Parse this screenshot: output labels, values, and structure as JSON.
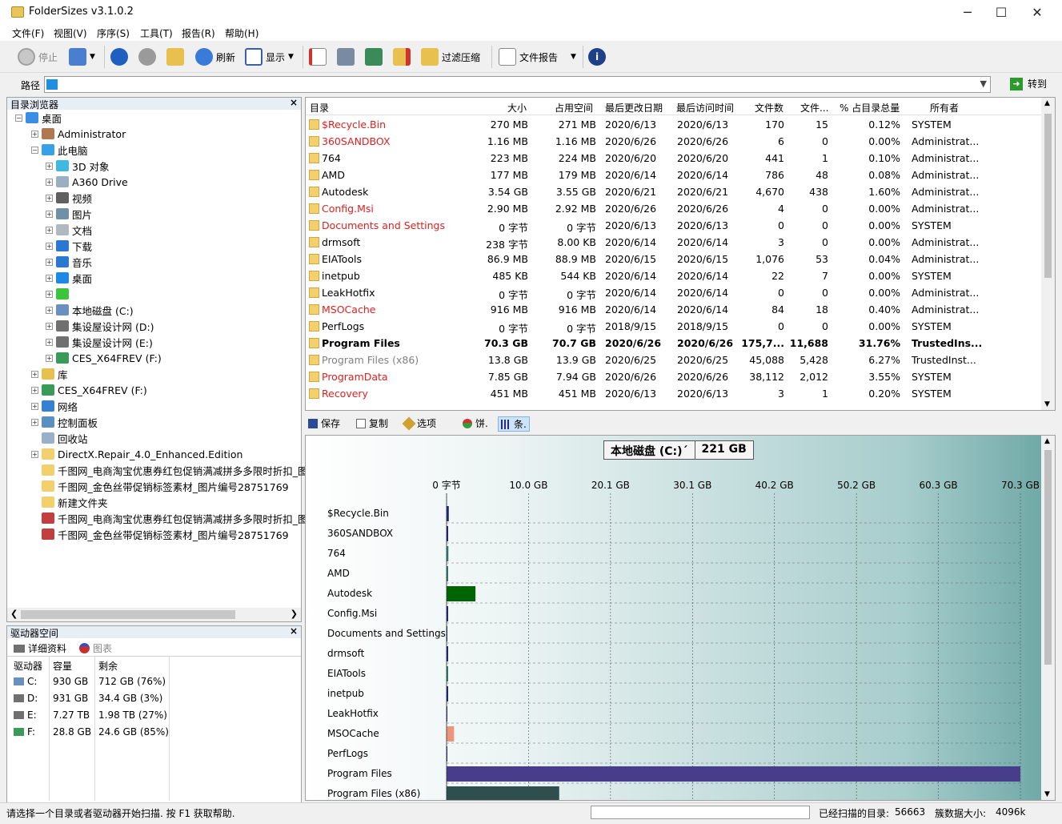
{
  "window": {
    "title": "FolderSizes v3.1.0.2",
    "minimize": "─",
    "maximize": "☐",
    "close": "✕"
  },
  "menu": [
    "文件(F)",
    "视图(V)",
    "序序(S)",
    "工具(T)",
    "报告(R)",
    "帮助(H)"
  ],
  "toolbar": {
    "stop": "停止",
    "refresh": "刷新",
    "display": "显示",
    "filter": "过滤压缩",
    "file_report": "文件报告"
  },
  "pathbar": {
    "label": "路径",
    "value": "",
    "goto": "转到"
  },
  "tree": {
    "header": "目录浏览器",
    "close": "×",
    "items": [
      {
        "label": "桌面",
        "indent": 0,
        "icon": "desktop-icon",
        "color": "#3a8ee6",
        "exp": "−"
      },
      {
        "label": "Administrator",
        "indent": 1,
        "icon": "user-icon",
        "color": "#b07850",
        "exp": "+"
      },
      {
        "label": "此电脑",
        "indent": 1,
        "icon": "computer-icon",
        "color": "#3aa0e6",
        "exp": "−"
      },
      {
        "label": "3D 对象",
        "indent": 2,
        "icon": "cube-icon",
        "color": "#40b8e0",
        "exp": "+"
      },
      {
        "label": "A360 Drive",
        "indent": 2,
        "icon": "cloud-icon",
        "color": "#9ab0c0",
        "exp": "+"
      },
      {
        "label": "视频",
        "indent": 2,
        "icon": "video-icon",
        "color": "#606060",
        "exp": "+"
      },
      {
        "label": "图片",
        "indent": 2,
        "icon": "picture-icon",
        "color": "#7090a8",
        "exp": "+"
      },
      {
        "label": "文档",
        "indent": 2,
        "icon": "document-icon",
        "color": "#b0b8c0",
        "exp": "+"
      },
      {
        "label": "下载",
        "indent": 2,
        "icon": "download-icon",
        "color": "#2a78d0",
        "exp": "+"
      },
      {
        "label": "音乐",
        "indent": 2,
        "icon": "music-icon",
        "color": "#2a78d0",
        "exp": "+"
      },
      {
        "label": "桌面",
        "indent": 2,
        "icon": "desktop-icon",
        "color": "#1e88e5",
        "exp": "+"
      },
      {
        "label": "",
        "indent": 2,
        "icon": "app-icon",
        "color": "#3cc43c",
        "exp": "+"
      },
      {
        "label": "本地磁盘 (C:)",
        "indent": 2,
        "icon": "drive-icon",
        "color": "#6a90c0",
        "exp": "+"
      },
      {
        "label": "集设屋设计网 (D:)",
        "indent": 2,
        "icon": "drive-icon",
        "color": "#707070",
        "exp": "+"
      },
      {
        "label": "集设屋设计网 (E:)",
        "indent": 2,
        "icon": "drive-icon",
        "color": "#707070",
        "exp": "+"
      },
      {
        "label": "CES_X64FREV (F:)",
        "indent": 2,
        "icon": "dvd-drive-icon",
        "color": "#3a9a5a",
        "exp": "+"
      },
      {
        "label": "库",
        "indent": 1,
        "icon": "library-icon",
        "color": "#e8c050",
        "exp": "+"
      },
      {
        "label": "CES_X64FREV (F:)",
        "indent": 1,
        "icon": "dvd-drive-icon",
        "color": "#3a9a5a",
        "exp": "+"
      },
      {
        "label": "网络",
        "indent": 1,
        "icon": "network-icon",
        "color": "#3a80d0",
        "exp": "+"
      },
      {
        "label": "控制面板",
        "indent": 1,
        "icon": "control-panel-icon",
        "color": "#5a90c0",
        "exp": "+"
      },
      {
        "label": "回收站",
        "indent": 1,
        "icon": "recycle-bin-icon",
        "color": "#9ab0c8",
        "exp": ""
      },
      {
        "label": "DirectX.Repair_4.0_Enhanced.Edition",
        "indent": 1,
        "icon": "folder-icon",
        "color": "#f2d06e",
        "exp": "+"
      },
      {
        "label": "千图网_电商淘宝优惠券红包促销满减拼多多限时折扣_图片",
        "indent": 1,
        "icon": "folder-icon",
        "color": "#f2d06e",
        "exp": ""
      },
      {
        "label": "千图网_金色丝带促销标签素材_图片编号28751769",
        "indent": 1,
        "icon": "folder-icon",
        "color": "#f2d06e",
        "exp": ""
      },
      {
        "label": "新建文件夹",
        "indent": 1,
        "icon": "folder-icon",
        "color": "#f2d06e",
        "exp": ""
      },
      {
        "label": "千图网_电商淘宝优惠券红包促销满减拼多多限时折扣_图片",
        "indent": 1,
        "icon": "archive-icon",
        "color": "#c04040",
        "exp": ""
      },
      {
        "label": "千图网_金色丝带促销标签素材_图片编号28751769",
        "indent": 1,
        "icon": "archive-icon",
        "color": "#c04040",
        "exp": ""
      }
    ]
  },
  "drives": {
    "header": "驱动器空间",
    "close": "×",
    "tab_details": "详细资料",
    "tab_chart": "图表",
    "columns": [
      "驱动器",
      "容量",
      "剩余"
    ],
    "rows": [
      {
        "drive": "C:",
        "capacity": "930 GB",
        "free": "712 GB (76%)",
        "color": "#6a90c0"
      },
      {
        "drive": "D:",
        "capacity": "931 GB",
        "free": "34.4 GB (3%)",
        "color": "#707070"
      },
      {
        "drive": "E:",
        "capacity": "7.27 TB",
        "free": "1.98 TB (27%)",
        "color": "#707070"
      },
      {
        "drive": "F:",
        "capacity": "28.8 GB",
        "free": "24.6 GB (85%)",
        "color": "#3a9a5a"
      }
    ]
  },
  "list": {
    "columns": [
      "目录",
      "大小",
      "占用空间",
      "最后更改日期",
      "最后访问时间",
      "文件数",
      "文件...",
      "% 占目录总量",
      "所有者"
    ],
    "rows": [
      {
        "name": "$Recycle.Bin",
        "size": "270 MB",
        "alloc": "271 MB",
        "modified": "2020/6/13",
        "accessed": "2020/6/13",
        "files": "170",
        "folders": "15",
        "pct": "0.12%",
        "owner": "SYSTEM",
        "style": "red"
      },
      {
        "name": "360SANDBOX",
        "size": "1.16 MB",
        "alloc": "1.16 MB",
        "modified": "2020/6/26",
        "accessed": "2020/6/26",
        "files": "6",
        "folders": "0",
        "pct": "0.00%",
        "owner": "Administrat...",
        "style": "red"
      },
      {
        "name": "764",
        "size": "223 MB",
        "alloc": "224 MB",
        "modified": "2020/6/20",
        "accessed": "2020/6/20",
        "files": "441",
        "folders": "1",
        "pct": "0.10%",
        "owner": "Administrat...",
        "style": "normal"
      },
      {
        "name": "AMD",
        "size": "177 MB",
        "alloc": "179 MB",
        "modified": "2020/6/14",
        "accessed": "2020/6/14",
        "files": "786",
        "folders": "48",
        "pct": "0.08%",
        "owner": "Administrat...",
        "style": "normal"
      },
      {
        "name": "Autodesk",
        "size": "3.54 GB",
        "alloc": "3.55 GB",
        "modified": "2020/6/21",
        "accessed": "2020/6/21",
        "files": "4,670",
        "folders": "438",
        "pct": "1.60%",
        "owner": "Administrat...",
        "style": "normal"
      },
      {
        "name": "Config.Msi",
        "size": "2.90 MB",
        "alloc": "2.92 MB",
        "modified": "2020/6/26",
        "accessed": "2020/6/26",
        "files": "4",
        "folders": "0",
        "pct": "0.00%",
        "owner": "Administrat...",
        "style": "red"
      },
      {
        "name": "Documents and Settings",
        "size": "0 字节",
        "alloc": "0 字节",
        "modified": "2020/6/13",
        "accessed": "2020/6/13",
        "files": "0",
        "folders": "0",
        "pct": "0.00%",
        "owner": "SYSTEM",
        "style": "red"
      },
      {
        "name": "drmsoft",
        "size": "238 字节",
        "alloc": "8.00 KB",
        "modified": "2020/6/14",
        "accessed": "2020/6/14",
        "files": "3",
        "folders": "0",
        "pct": "0.00%",
        "owner": "Administrat...",
        "style": "normal"
      },
      {
        "name": "EIATools",
        "size": "86.9 MB",
        "alloc": "88.9 MB",
        "modified": "2020/6/15",
        "accessed": "2020/6/15",
        "files": "1,076",
        "folders": "53",
        "pct": "0.04%",
        "owner": "Administrat...",
        "style": "normal"
      },
      {
        "name": "inetpub",
        "size": "485 KB",
        "alloc": "544 KB",
        "modified": "2020/6/14",
        "accessed": "2020/6/14",
        "files": "22",
        "folders": "7",
        "pct": "0.00%",
        "owner": "SYSTEM",
        "style": "normal"
      },
      {
        "name": "LeakHotfix",
        "size": "0 字节",
        "alloc": "0 字节",
        "modified": "2020/6/14",
        "accessed": "2020/6/14",
        "files": "0",
        "folders": "0",
        "pct": "0.00%",
        "owner": "Administrat...",
        "style": "normal"
      },
      {
        "name": "MSOCache",
        "size": "916 MB",
        "alloc": "916 MB",
        "modified": "2020/6/14",
        "accessed": "2020/6/14",
        "files": "84",
        "folders": "18",
        "pct": "0.40%",
        "owner": "Administrat...",
        "style": "red"
      },
      {
        "name": "PerfLogs",
        "size": "0 字节",
        "alloc": "0 字节",
        "modified": "2018/9/15",
        "accessed": "2018/9/15",
        "files": "0",
        "folders": "0",
        "pct": "0.00%",
        "owner": "SYSTEM",
        "style": "normal"
      },
      {
        "name": "Program Files",
        "size": "70.3 GB",
        "alloc": "70.7 GB",
        "modified": "2020/6/26",
        "accessed": "2020/6/26",
        "files": "175,7...",
        "folders": "11,688",
        "pct": "31.76%",
        "owner": "TrustedIns...",
        "style": "bold"
      },
      {
        "name": "Program Files (x86)",
        "size": "13.8 GB",
        "alloc": "13.9 GB",
        "modified": "2020/6/25",
        "accessed": "2020/6/25",
        "files": "45,088",
        "folders": "5,428",
        "pct": "6.27%",
        "owner": "TrustedInst...",
        "style": "gray"
      },
      {
        "name": "ProgramData",
        "size": "7.85 GB",
        "alloc": "7.94 GB",
        "modified": "2020/6/26",
        "accessed": "2020/6/26",
        "files": "38,112",
        "folders": "2,012",
        "pct": "3.55%",
        "owner": "SYSTEM",
        "style": "red"
      },
      {
        "name": "Recovery",
        "size": "451 MB",
        "alloc": "451 MB",
        "modified": "2020/6/13",
        "accessed": "2020/6/13",
        "files": "3",
        "folders": "1",
        "pct": "0.20%",
        "owner": "SYSTEM",
        "style": "red"
      }
    ]
  },
  "chart_toolbar": {
    "save": "保存",
    "copy": "复制",
    "options": "选项",
    "pie": "饼.",
    "bar": "条."
  },
  "chart_data": {
    "type": "bar",
    "orientation": "horizontal",
    "title": "本地磁盘 (C:)´",
    "title_value": "221 GB",
    "x_ticks": [
      "0 字节",
      "10.0 GB",
      "20.1 GB",
      "30.1 GB",
      "40.2 GB",
      "50.2 GB",
      "60.3 GB",
      "70.3 GB"
    ],
    "xlim": [
      0,
      70.3
    ],
    "grid": true,
    "categories": [
      "$Recycle.Bin",
      "360SANDBOX",
      "764",
      "AMD",
      "Autodesk",
      "Config.Msi",
      "Documents and Settings",
      "drmsoft",
      "EIATools",
      "inetpub",
      "LeakHotfix",
      "MSOCache",
      "PerfLogs",
      "Program Files",
      "Program Files (x86)"
    ],
    "values": [
      0.27,
      0.00116,
      0.223,
      0.177,
      3.54,
      0.0029,
      0,
      2e-07,
      0.0869,
      0.000485,
      0,
      0.916,
      0,
      70.3,
      13.8
    ],
    "colors": [
      "#1a237e",
      "#1a237e",
      "#2e7d6f",
      "#2e7d6f",
      "#006400",
      "#1a237e",
      "#1a237e",
      "#1a237e",
      "#2e7d6f",
      "#1a237e",
      "#1a237e",
      "#e9967a",
      "#1a237e",
      "#483d8b",
      "#2f4f4f"
    ]
  },
  "status": {
    "message": "请选择一个目录或者驱动器开始扫描. 按 F1 获取帮助.",
    "scanned_label": "已经扫描的目录:",
    "scanned_value": "56663",
    "cluster_label": "簇数据大小:",
    "cluster_value": "4096k"
  }
}
